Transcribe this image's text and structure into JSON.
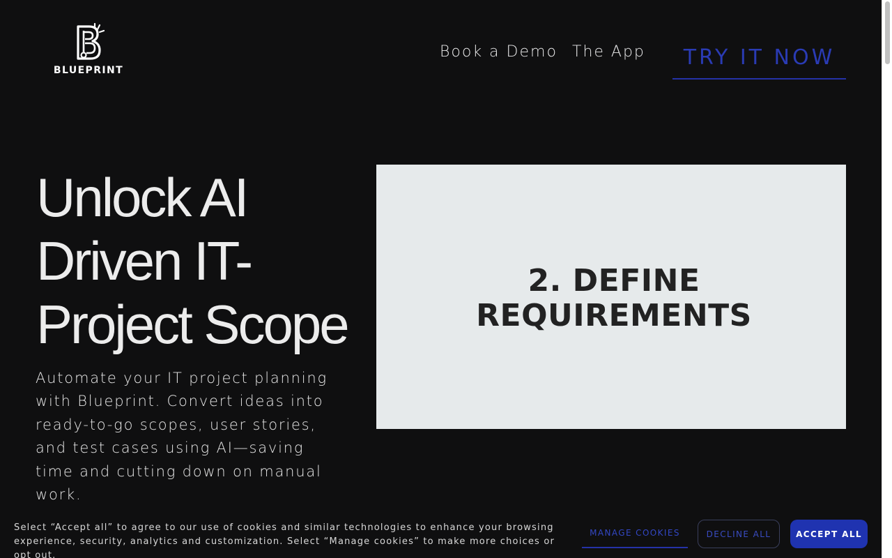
{
  "brand": {
    "name": "BLUEPRINT",
    "logo_icon": "blueprint-b-logo-icon"
  },
  "nav": {
    "book_demo": "Book a Demo",
    "the_app": "The App",
    "try_now": "TRY IT NOW"
  },
  "hero": {
    "title_lines": [
      "Unlock AI",
      "Driven IT-",
      "Project Scope"
    ],
    "description": "Automate your IT project planning with Blueprint. Convert ideas into ready-to-go scopes, user stories, and test cases using AI—saving time and cutting down on manual work.",
    "slide_lines": [
      "2. DEFINE",
      "REQUIREMENTS"
    ]
  },
  "cookies": {
    "text": "Select “Accept all” to agree to our use of cookies and similar technologies to enhance your browsing experience, security, analytics and customization. Select “Manage cookies” to make more choices or opt out.",
    "manage": "MANAGE COOKIES",
    "decline": "DECLINE ALL",
    "accept": "ACCEPT ALL"
  },
  "colors": {
    "background": "#0f0f10",
    "accent": "#2532a8",
    "accept_button": "#1f33b0",
    "slide_background": "#e6eaeb"
  }
}
